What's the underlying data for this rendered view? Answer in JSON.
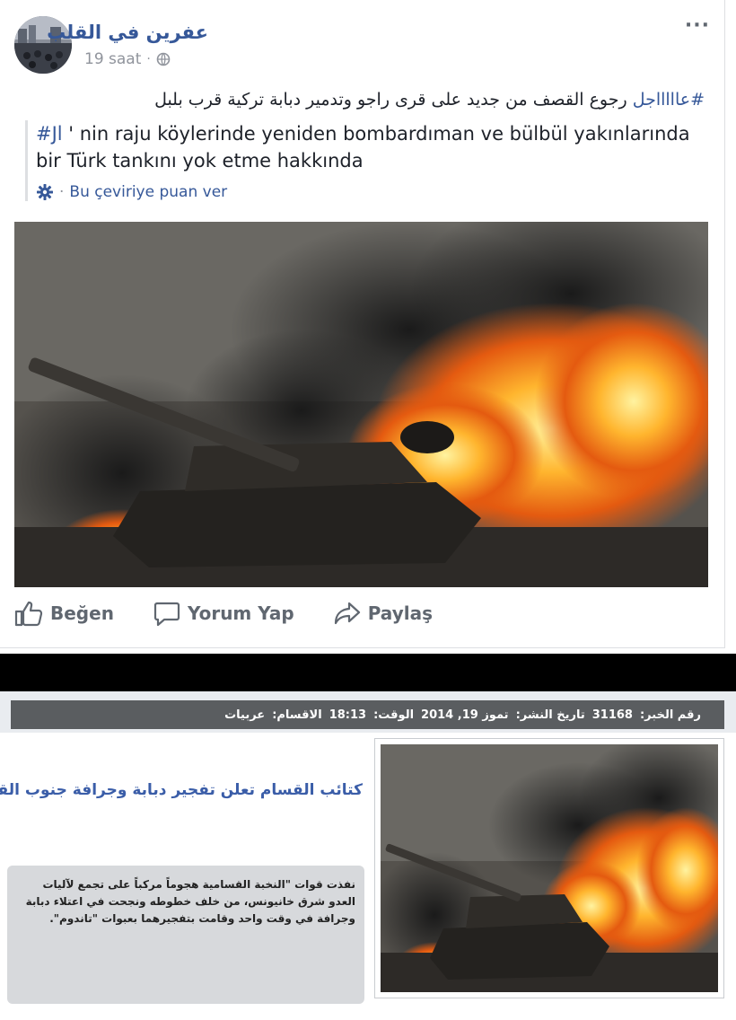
{
  "post": {
    "page_name": "عفرين في القلب",
    "time": "19 saat",
    "meta_separator": "·",
    "privacy_icon": "globe-icon",
    "more_label": "···",
    "text_hashtag": "#عاااااجل",
    "text_body": " رجوع القصف من جديد على قرى راجو وتدمير دبابة تركية قرب بلبل",
    "translation_hashtag": "#Jl",
    "translation_body": " ' nin raju köylerinde yeniden bombardıman ve bülbül yakınlarında bir Türk tankını yok etme hakkında",
    "rate_dot": "·",
    "rate_label": "Bu çeviriye puan ver",
    "image_icon": "burning-tank-photo",
    "actions": [
      {
        "label": "Beğen",
        "icon": "thumbs-up-icon"
      },
      {
        "label": "Yorum Yap",
        "icon": "comment-icon"
      },
      {
        "label": "Paylaş",
        "icon": "share-icon"
      }
    ],
    "colors": {
      "link": "#365899",
      "text": "#1d2129",
      "muted": "#90949c"
    }
  },
  "news": {
    "meta_bar": {
      "id_label": "رقم الخبر:",
      "id_value": "31168",
      "date_label": "تاريخ النشر:",
      "date_value": "تموز 19, 2014",
      "time_label": "الوقت:",
      "time_value": "18:13",
      "section_label": "الاقسام:",
      "section_value": "عربيات"
    },
    "headline": "كتائب القسام تعلن تفجير دبابة وجرافة جنوب القطاع",
    "body": "نفذت قوات \"النخبة القسامية هجوماً مركباً على تجمع لآليات العدو شرق خانيونس، من خلف خطوطه ونجحت في اعتلاء دبابة وجرافة في وقت واحد وقامت بتفجيرهما بعبوات \"تاندوم\".",
    "colors": {
      "headline": "#3a5da8",
      "bar": "#5a5d60"
    }
  }
}
